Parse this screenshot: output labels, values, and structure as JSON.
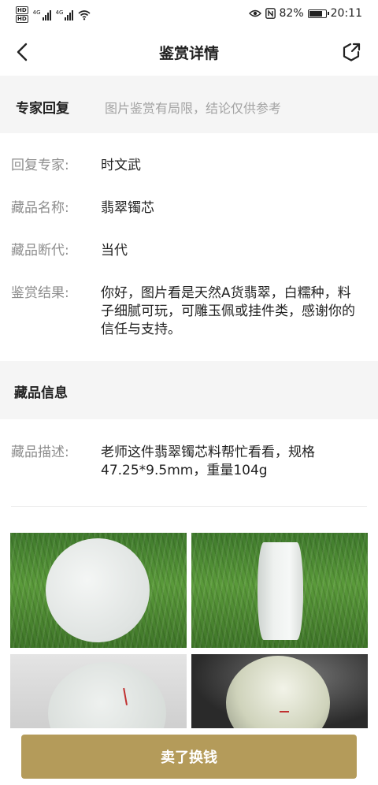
{
  "status_bar": {
    "hd_1": "HD",
    "hd_2": "HD",
    "signal_1": "4G",
    "signal_2": "4G",
    "battery_percent": "82%",
    "battery_level": 0.82,
    "time": "20:11"
  },
  "header": {
    "title": "鉴赏详情",
    "back_icon": "chevron-left-icon",
    "share_icon": "share-icon"
  },
  "expert_section": {
    "title": "专家回复",
    "note": "图片鉴赏有局限，结论仅供参考"
  },
  "fields": [
    {
      "label": "回复专家:",
      "value": "时文武"
    },
    {
      "label": "藏品名称:",
      "value": "翡翠镯芯"
    },
    {
      "label": "藏品断代:",
      "value": "当代"
    },
    {
      "label": "鉴赏结果:",
      "value": "你好，图片看是天然A货翡翠，白糯种，料子细腻可玩，可雕玉佩或挂件类，感谢你的信任与支持。"
    }
  ],
  "collection_section": {
    "title": "藏品信息",
    "desc_label": "藏品描述:",
    "desc_value": "老师这件翡翠镯芯料帮忙看看，规格47.25*9.5mm，重量104g"
  },
  "photos": [
    "photo-front",
    "photo-side",
    "photo-back",
    "photo-lit"
  ],
  "actions": {
    "sell_label": "卖了换钱"
  },
  "colors": {
    "accent": "#b49b5a",
    "band_bg": "#f5f5f5",
    "label_gray": "#8d8d8d"
  }
}
